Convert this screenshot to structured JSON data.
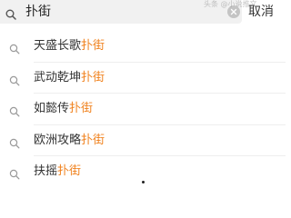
{
  "search": {
    "query": "扑街",
    "cancel_label": "取消",
    "watermark": "头条 @小说推文"
  },
  "suggestions": [
    {
      "prefix": "天盛长歌",
      "match": "扑街"
    },
    {
      "prefix": "武动乾坤",
      "match": "扑街"
    },
    {
      "prefix": "如懿传",
      "match": "扑街"
    },
    {
      "prefix": "欧洲攻略",
      "match": "扑街"
    },
    {
      "prefix": "扶摇",
      "match": "扑街"
    }
  ],
  "colors": {
    "highlight": "#f0821e",
    "search_bg": "#f1f1f1"
  },
  "icons": {
    "search": "search-icon",
    "clear": "clear-icon"
  }
}
